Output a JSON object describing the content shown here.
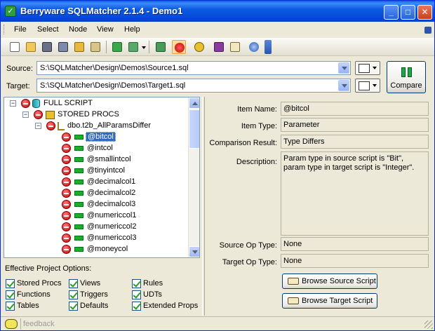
{
  "window": {
    "title": "Berryware SQLMatcher 2.1.4 - Demo1",
    "app_icon": "sqlmatcher-logo-icon",
    "controls": {
      "minimize": "_",
      "maximize": "□",
      "close": "✕"
    }
  },
  "menu": [
    {
      "label": "File"
    },
    {
      "label": "Select"
    },
    {
      "label": "Node"
    },
    {
      "label": "View"
    },
    {
      "label": "Help"
    }
  ],
  "paths": {
    "source_label": "Source:",
    "source_value": "S:\\SQLMatcher\\Design\\Demos\\Source1.sql",
    "target_label": "Target:",
    "target_value": "S:\\SQLMatcher\\Design\\Demos\\Target1.sql",
    "compare_label": "Compare"
  },
  "tree": {
    "rows": [
      {
        "text": "FULL SCRIPT",
        "level": 0
      },
      {
        "text": "STORED PROCS",
        "level": 1
      },
      {
        "text": "dbo.t2b_AllParamsDiffer",
        "level": 2
      },
      {
        "text": "@bitcol",
        "level": 3,
        "selected": true
      },
      {
        "text": "@intcol",
        "level": 3
      },
      {
        "text": "@smallintcol",
        "level": 3
      },
      {
        "text": "@tinyintcol",
        "level": 3
      },
      {
        "text": "@decimalcol1",
        "level": 3
      },
      {
        "text": "@decimalcol2",
        "level": 3
      },
      {
        "text": "@decimalcol3",
        "level": 3
      },
      {
        "text": "@numericcol1",
        "level": 3
      },
      {
        "text": "@numericcol2",
        "level": 3
      },
      {
        "text": "@numericcol3",
        "level": 3
      },
      {
        "text": "@moneycol",
        "level": 3
      }
    ]
  },
  "options": {
    "title": "Effective Project Options:",
    "items": [
      {
        "label": "Stored Procs",
        "checked": true
      },
      {
        "label": "Views",
        "checked": true
      },
      {
        "label": "Rules",
        "checked": true
      },
      {
        "label": "Functions",
        "checked": true
      },
      {
        "label": "Triggers",
        "checked": true
      },
      {
        "label": "UDTs",
        "checked": true
      },
      {
        "label": "Tables",
        "checked": true
      },
      {
        "label": "Defaults",
        "checked": true
      },
      {
        "label": "Extended Props",
        "checked": true
      }
    ]
  },
  "details": {
    "item_name_label": "Item Name:",
    "item_name": "@bitcol",
    "item_type_label": "Item Type:",
    "item_type": "Parameter",
    "comparison_label": "Comparison Result:",
    "comparison": "Type Differs",
    "description_label": "Description:",
    "description": "Param type in source script is \"Bit\", param type in target script is \"Integer\".",
    "source_op_label": "Source Op Type:",
    "source_op": "None",
    "target_op_label": "Target Op Type:",
    "target_op": "None",
    "browse_source_label": "Browse Source Script",
    "browse_target_label": "Browse Target Script"
  },
  "status": {
    "text": "feedback"
  }
}
